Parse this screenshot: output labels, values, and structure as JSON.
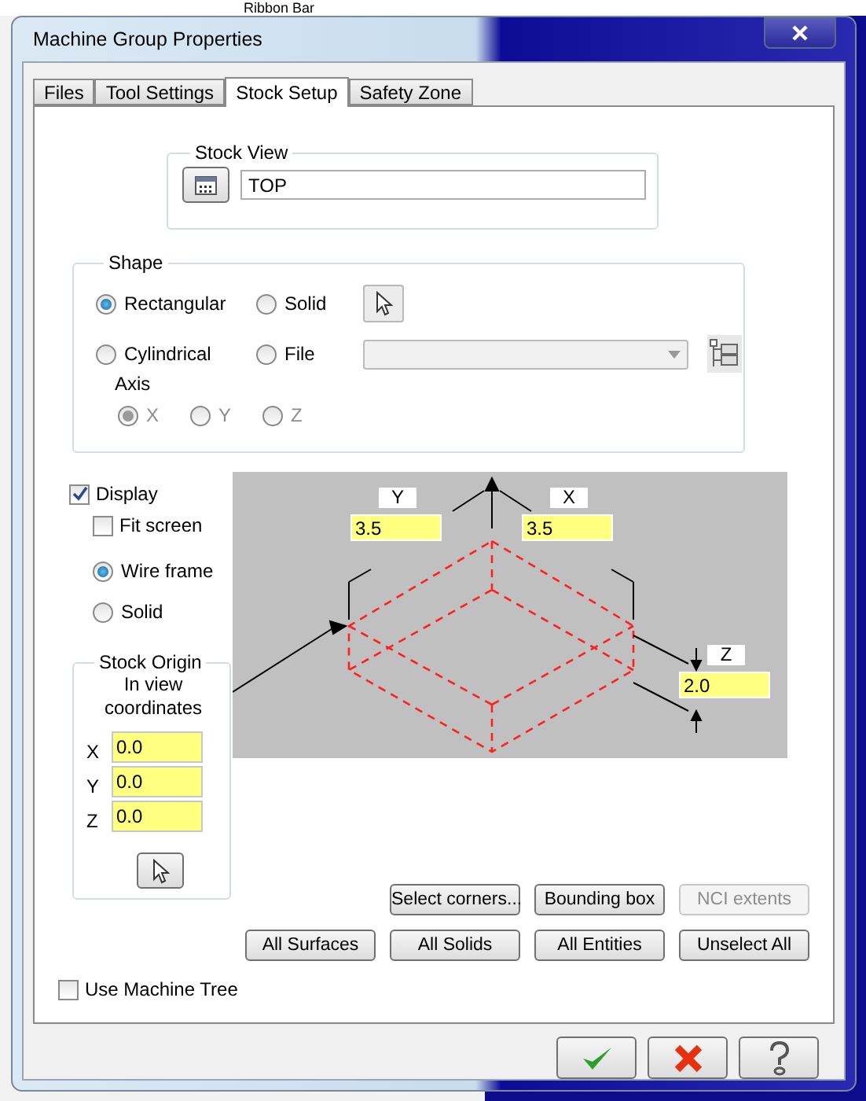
{
  "background": {
    "ribbon_label": "Ribbon Bar"
  },
  "window": {
    "title": "Machine Group Properties"
  },
  "tabs": [
    {
      "label": "Files",
      "selected": false
    },
    {
      "label": "Tool Settings",
      "selected": false
    },
    {
      "label": "Stock Setup",
      "selected": true
    },
    {
      "label": "Safety Zone",
      "selected": false
    }
  ],
  "stock_view": {
    "legend": "Stock View",
    "value": "TOP"
  },
  "shape": {
    "legend": "Shape",
    "options": [
      {
        "label": "Rectangular",
        "selected": true
      },
      {
        "label": "Solid",
        "selected": false
      },
      {
        "label": "Cylindrical",
        "selected": false
      },
      {
        "label": "File",
        "selected": false
      }
    ],
    "file_field_disabled": true,
    "axis_label": "Axis",
    "axes_disabled": true,
    "axes": [
      {
        "label": "X",
        "selected": true
      },
      {
        "label": "Y",
        "selected": false
      },
      {
        "label": "Z",
        "selected": false
      }
    ]
  },
  "display": {
    "label": "Display",
    "checked": true
  },
  "fit_screen": {
    "label": "Fit screen",
    "checked": false
  },
  "render_modes": [
    {
      "label": "Wire frame",
      "selected": true
    },
    {
      "label": "Solid",
      "selected": false
    }
  ],
  "stock_origin": {
    "legend": "Stock Origin",
    "caption": "In view coordinates",
    "fields": [
      {
        "label": "X",
        "value": "0.0"
      },
      {
        "label": "Y",
        "value": "0.0"
      },
      {
        "label": "Z",
        "value": "0.0"
      }
    ]
  },
  "preview": {
    "y_label": "Y",
    "y_value": "3.5",
    "x_label": "X",
    "x_value": "3.5",
    "z_label": "Z",
    "z_value": "2.0"
  },
  "button_rows": [
    [
      {
        "label": "Select corners...",
        "disabled": false
      },
      {
        "label": "Bounding box",
        "disabled": false
      },
      {
        "label": "NCI extents",
        "disabled": true
      }
    ],
    [
      {
        "label": "All Surfaces",
        "disabled": false
      },
      {
        "label": "All Solids",
        "disabled": false
      },
      {
        "label": "All Entities",
        "disabled": false
      },
      {
        "label": "Unselect All",
        "disabled": false
      }
    ]
  ],
  "use_machine_tree": {
    "label": "Use Machine Tree",
    "checked": false
  }
}
